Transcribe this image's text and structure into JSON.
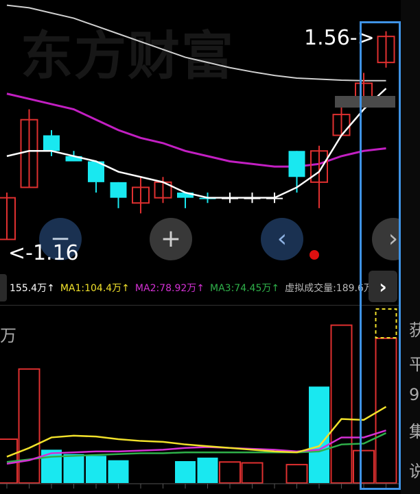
{
  "watermark": "东方财富",
  "annotations": {
    "high": "1.56->",
    "low": "<-1.16"
  },
  "controls": {
    "zoom_out": "−",
    "zoom_in": "+",
    "prev": "‹",
    "next": "›"
  },
  "volume_legend": {
    "volume": "155.4万↑",
    "ma1": "MA1:104.4万↑",
    "ma2": "MA2:78.92万↑",
    "ma3": "MA3:74.45万↑",
    "virtual": "虚拟成交量:189.6万",
    "expand": "›"
  },
  "right_rail": [
    "获",
    "平",
    "9",
    "集",
    "说"
  ],
  "volume_unit": "万",
  "colors": {
    "up": "#e03030",
    "down": "#19e8f0",
    "ma_white": "#ffffff",
    "ma_purple": "#c21fc2",
    "ma_gray": "#d0d0d0",
    "vol_ma1": "#f1e12b",
    "vol_ma2": "#d431d4",
    "vol_ma3": "#2fb14a",
    "highlight": "#3f93e5"
  },
  "chart_data": [
    {
      "type": "candlestick",
      "candles": [
        {
          "o": 1.16,
          "c": 1.24,
          "h": 1.25,
          "l": 1.16,
          "dir": "up"
        },
        {
          "o": 1.26,
          "c": 1.39,
          "h": 1.41,
          "l": 1.26,
          "dir": "up"
        },
        {
          "o": 1.36,
          "c": 1.33,
          "h": 1.37,
          "l": 1.32,
          "dir": "down"
        },
        {
          "o": 1.32,
          "c": 1.31,
          "h": 1.33,
          "l": 1.31,
          "dir": "down"
        },
        {
          "o": 1.31,
          "c": 1.27,
          "h": 1.31,
          "l": 1.25,
          "dir": "down"
        },
        {
          "o": 1.27,
          "c": 1.24,
          "h": 1.27,
          "l": 1.22,
          "dir": "down"
        },
        {
          "o": 1.23,
          "c": 1.26,
          "h": 1.28,
          "l": 1.21,
          "dir": "up"
        },
        {
          "o": 1.24,
          "c": 1.27,
          "h": 1.28,
          "l": 1.23,
          "dir": "up"
        },
        {
          "o": 1.25,
          "c": 1.24,
          "h": 1.25,
          "l": 1.22,
          "dir": "down"
        },
        {
          "o": 1.24,
          "c": 1.24,
          "h": 1.25,
          "l": 1.23,
          "dir": "down"
        },
        {
          "o": 1.24,
          "c": 1.24,
          "h": 1.25,
          "l": 1.23,
          "dir": "flat"
        },
        {
          "o": 1.24,
          "c": 1.24,
          "h": 1.25,
          "l": 1.23,
          "dir": "flat"
        },
        {
          "o": 1.24,
          "c": 1.24,
          "h": 1.25,
          "l": 1.23,
          "dir": "flat"
        },
        {
          "o": 1.33,
          "c": 1.28,
          "h": 1.33,
          "l": 1.25,
          "dir": "down"
        },
        {
          "o": 1.27,
          "c": 1.33,
          "h": 1.34,
          "l": 1.22,
          "dir": "up"
        },
        {
          "o": 1.36,
          "c": 1.4,
          "h": 1.42,
          "l": 1.36,
          "dir": "up"
        },
        {
          "o": 1.43,
          "c": 1.46,
          "h": 1.48,
          "l": 1.43,
          "dir": "up"
        },
        {
          "o": 1.5,
          "c": 1.55,
          "h": 1.56,
          "l": 1.49,
          "dir": "up"
        }
      ],
      "ma_white": [
        1.32,
        1.33,
        1.33,
        1.32,
        1.31,
        1.29,
        1.28,
        1.27,
        1.25,
        1.24,
        1.24,
        1.24,
        1.24,
        1.26,
        1.29,
        1.36,
        1.41,
        1.45
      ],
      "ma_purple": [
        1.44,
        1.43,
        1.42,
        1.41,
        1.39,
        1.37,
        1.355,
        1.345,
        1.33,
        1.32,
        1.31,
        1.305,
        1.3,
        1.3,
        1.305,
        1.32,
        1.33,
        1.335
      ],
      "ma_gray": [
        1.61,
        1.605,
        1.595,
        1.585,
        1.57,
        1.555,
        1.54,
        1.525,
        1.51,
        1.5,
        1.49,
        1.482,
        1.475,
        1.47,
        1.468,
        1.466,
        1.465,
        1.465
      ],
      "ylim": [
        1.1,
        1.62
      ]
    },
    {
      "type": "bar",
      "volumes": [
        50,
        130,
        38,
        33,
        31,
        26,
        0,
        0,
        25,
        29,
        24,
        23,
        0,
        21,
        110,
        180,
        37,
        165
      ],
      "colors": [
        "up",
        "up",
        "down",
        "down",
        "down",
        "down",
        "none",
        "none",
        "down",
        "down",
        "up",
        "up",
        "none",
        "up",
        "down",
        "up",
        "up",
        "up"
      ],
      "ma1": [
        30,
        40,
        52,
        54,
        53,
        50,
        48,
        47,
        44,
        42,
        40,
        38,
        36,
        35,
        42,
        73,
        72,
        87
      ],
      "ma2": [
        22,
        26,
        34,
        35,
        36,
        36,
        37,
        38,
        40,
        41,
        40,
        39,
        38,
        36,
        38,
        52,
        52,
        60
      ],
      "ma3": [
        24,
        27,
        30,
        31,
        32,
        33,
        34,
        34,
        35,
        35,
        35,
        35,
        35,
        35,
        36,
        44,
        45,
        57
      ],
      "ylim": [
        0,
        200
      ]
    }
  ]
}
